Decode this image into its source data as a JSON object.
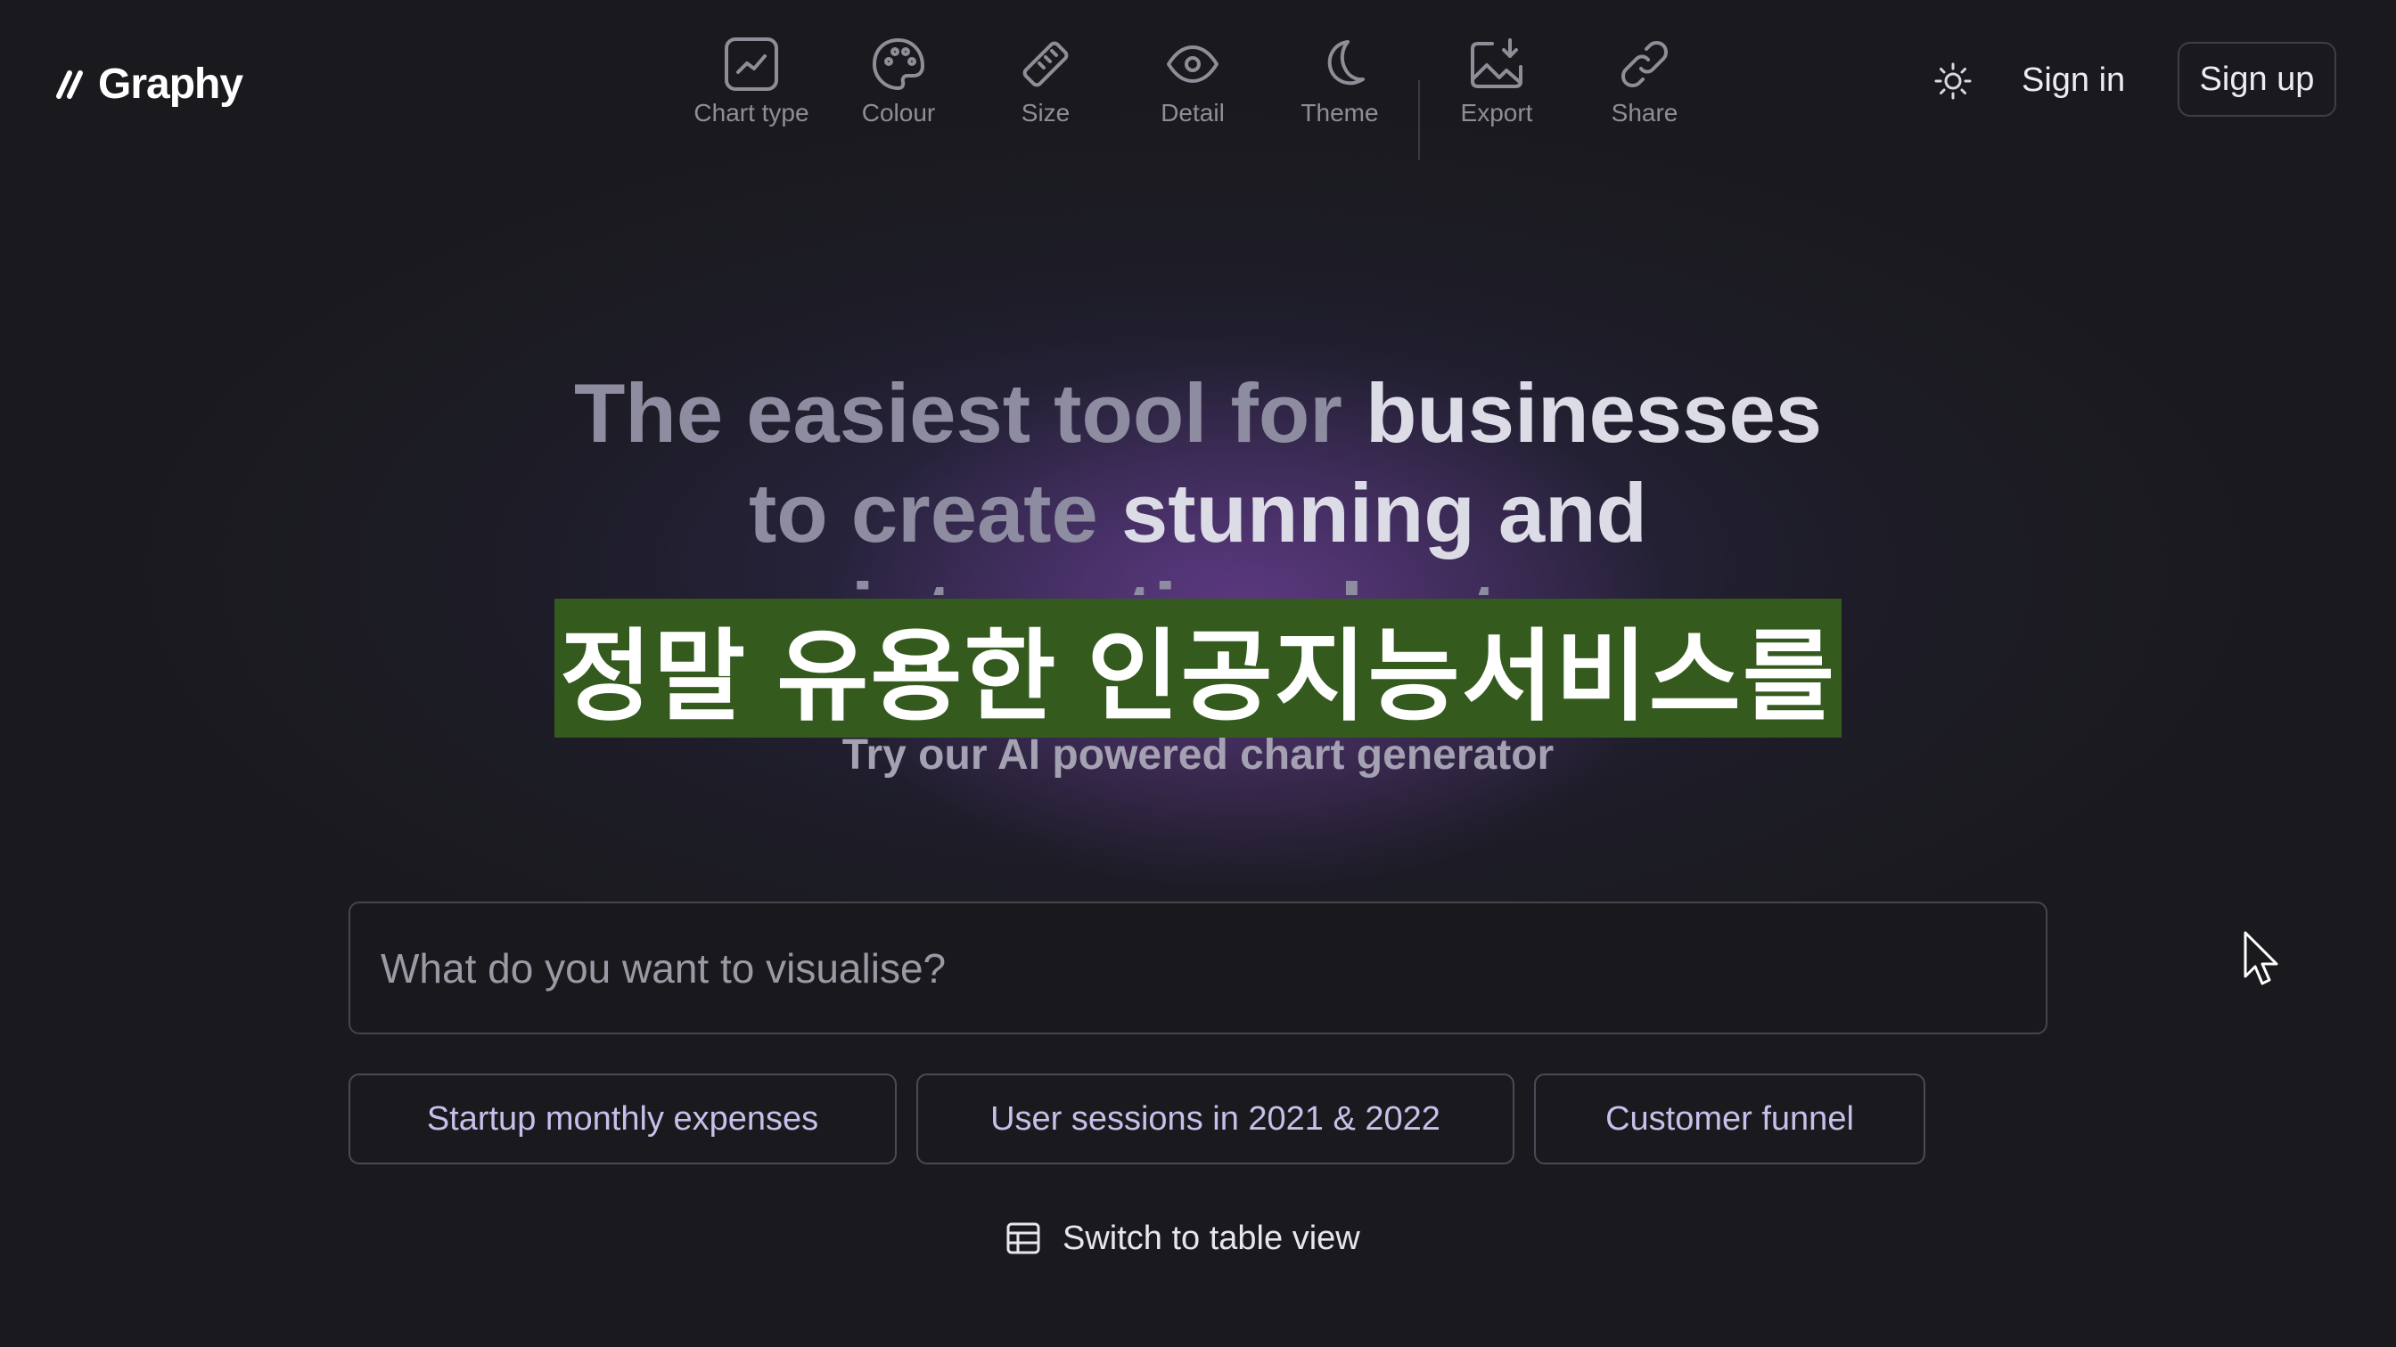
{
  "logo": {
    "text": "Graphy"
  },
  "toolbar": {
    "items": [
      {
        "label": "Chart type",
        "icon": "line-chart-icon"
      },
      {
        "label": "Colour",
        "icon": "palette-icon"
      },
      {
        "label": "Size",
        "icon": "ruler-icon"
      },
      {
        "label": "Detail",
        "icon": "eye-icon"
      },
      {
        "label": "Theme",
        "icon": "moon-icon"
      },
      {
        "label": "Export",
        "icon": "image-download-icon"
      },
      {
        "label": "Share",
        "icon": "link-icon"
      }
    ]
  },
  "header": {
    "theme_toggle_icon": "sun-icon",
    "sign_in": "Sign in",
    "sign_up": "Sign up"
  },
  "hero": {
    "headline_part1": "The easiest tool for ",
    "headline_part2": "businesses",
    "headline_part3": "to create ",
    "headline_part4": "stunning and",
    "headline_line3": "interactive charts",
    "subtitle_overlay": "정말 유용한 인공지능서비스를",
    "tagline": "Try our AI powered chart generator"
  },
  "prompt": {
    "placeholder": "What do you want to visualise?",
    "value": ""
  },
  "suggestions": [
    "Startup monthly expenses",
    "User sessions in 2021 & 2022",
    "Customer funnel"
  ],
  "switch_view": {
    "label": "Switch to table view",
    "icon": "table-icon"
  },
  "colors": {
    "background": "#1a1a1e",
    "subtitle_bar": "#345a1e",
    "chip_text": "#c6c0ea",
    "glow": "#5a3a8c"
  }
}
